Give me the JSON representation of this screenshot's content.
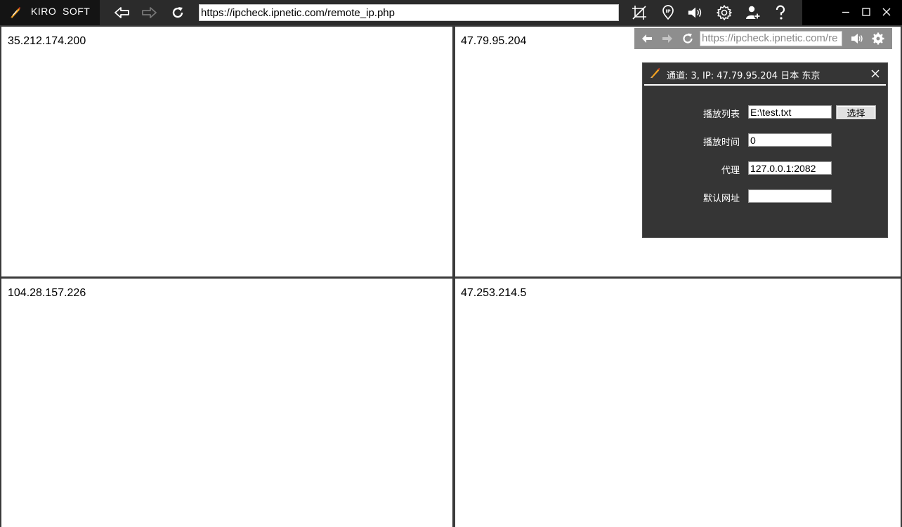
{
  "app": {
    "brand": "KIRO  SOFT",
    "url": "https://ipcheck.ipnetic.com/remote_ip.php"
  },
  "panes": [
    {
      "ip": "35.212.174.200"
    },
    {
      "ip": "47.79.95.204"
    },
    {
      "ip": "104.28.157.226"
    },
    {
      "ip": "47.253.214.5"
    }
  ],
  "mini_nav": {
    "url": "https://ipcheck.ipnetic.com/re"
  },
  "dialog": {
    "title": "通道: 3, IP: 47.79.95.204 日本 东京",
    "fields": [
      {
        "label": "播放列表",
        "value": "E:\\test.txt"
      },
      {
        "label": "播放时间",
        "value": "0"
      },
      {
        "label": "代理",
        "value": "127.0.0.1:2082"
      },
      {
        "label": "默认网址",
        "value": ""
      }
    ],
    "choose_label": "选择"
  },
  "colors": {
    "titlebar": "#000000",
    "toolbar": "#2b2b2b",
    "dialog_bg": "#353535",
    "mini_nav_bg": "#8e8e8e"
  },
  "icons": {
    "brand": "feather-pen-icon",
    "back": "back-arrow-icon",
    "forward": "forward-arrow-icon",
    "refresh": "refresh-icon",
    "no-crop": "crop-off-icon",
    "ip-location": "ip-location-icon",
    "volume": "volume-icon",
    "settings": "gear-icon",
    "add-user": "add-user-icon",
    "help": "help-icon",
    "minimize": "minimize-icon",
    "maximize": "maximize-icon",
    "close": "close-icon"
  }
}
